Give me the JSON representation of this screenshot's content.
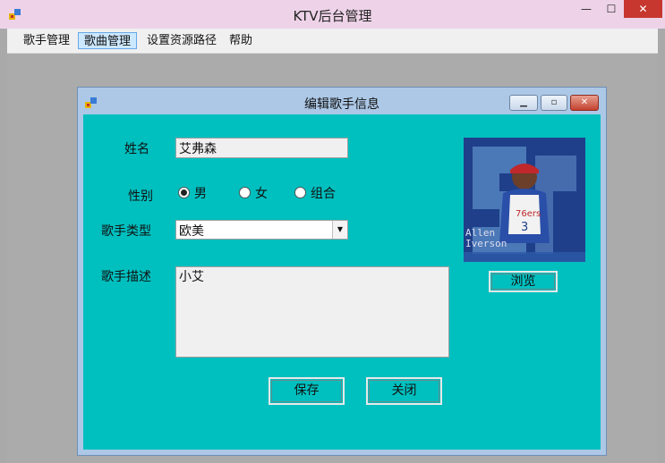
{
  "app": {
    "title": "KTV后台管理",
    "icon": "app-icon"
  },
  "window_controls": {
    "minimize": "—",
    "maximize": "☐",
    "close": "✕"
  },
  "menu": {
    "items": [
      "歌手管理",
      "歌曲管理",
      "设置资源路径",
      "帮助"
    ],
    "active_index": 1
  },
  "dialog": {
    "title": "编辑歌手信息",
    "labels": {
      "name": "姓名",
      "gender": "性别",
      "type": "歌手类型",
      "description": "歌手描述"
    },
    "name_value": "艾弗森",
    "gender_options": [
      "男",
      "女",
      "组合"
    ],
    "gender_selected": "男",
    "type_value": "欧美",
    "description_value": "小艾",
    "photo_overlay_text": [
      "Allen",
      "Iverson"
    ],
    "buttons": {
      "browse": "浏览",
      "save": "保存",
      "close": "关闭"
    }
  },
  "colors": {
    "client_bg": "#00bfbf",
    "titlebar": "#eed3e8",
    "mdi_bg": "#ababab"
  }
}
